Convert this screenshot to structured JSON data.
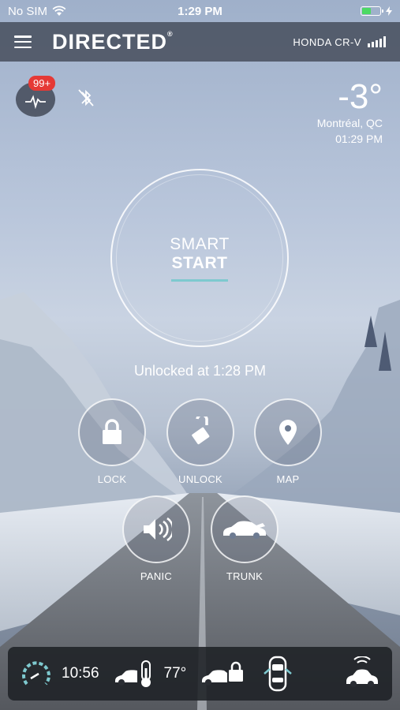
{
  "status_bar": {
    "carrier": "No SIM",
    "time": "1:29 PM"
  },
  "app_bar": {
    "brand": "DIRECTED",
    "trademark": "®",
    "vehicle": "HONDA CR-V"
  },
  "notifications": {
    "badge": "99+"
  },
  "weather": {
    "temperature": "-3°",
    "city": "Montréal, QC",
    "time": "01:29 PM"
  },
  "smart_start": {
    "line1": "SMART",
    "line2": "START"
  },
  "lock_status": "Unlocked at 1:28 PM",
  "actions": {
    "lock": "LOCK",
    "unlock": "UNLOCK",
    "map": "MAP",
    "panic": "PANIC",
    "trunk": "TRUNK"
  },
  "bottom_bar": {
    "runtime": "10:56",
    "interior_temp": "77°"
  },
  "colors": {
    "accent": "#7ec9cf",
    "badge": "#e53935",
    "battery": "#4cd964"
  }
}
